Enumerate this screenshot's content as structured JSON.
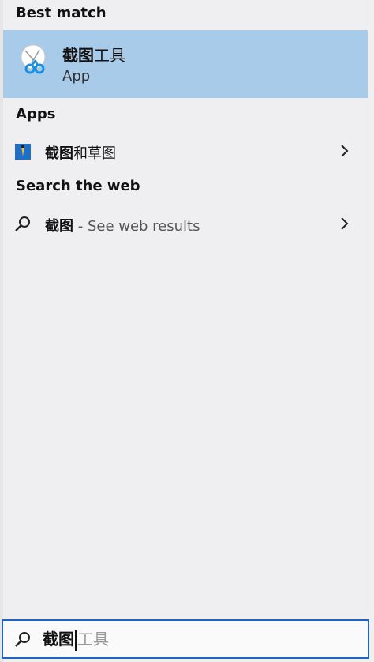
{
  "sections": {
    "best_match": "Best match",
    "apps": "Apps",
    "search_web": "Search the web"
  },
  "best_match": {
    "title_bold": "截图",
    "title_rest": "工具",
    "subtitle": "App",
    "icon": "snipping-tool-icon"
  },
  "apps": [
    {
      "title_bold": "截图",
      "title_rest": "和草图",
      "icon": "snip-and-sketch-icon"
    }
  ],
  "web": {
    "query": "截图",
    "suffix": " - See web results"
  },
  "searchbar": {
    "typed": "截图",
    "suggestion": "工具"
  },
  "colors": {
    "selected_row": "#a9cbea",
    "search_border": "#1e64c8",
    "panel_bg": "#efeff1"
  }
}
